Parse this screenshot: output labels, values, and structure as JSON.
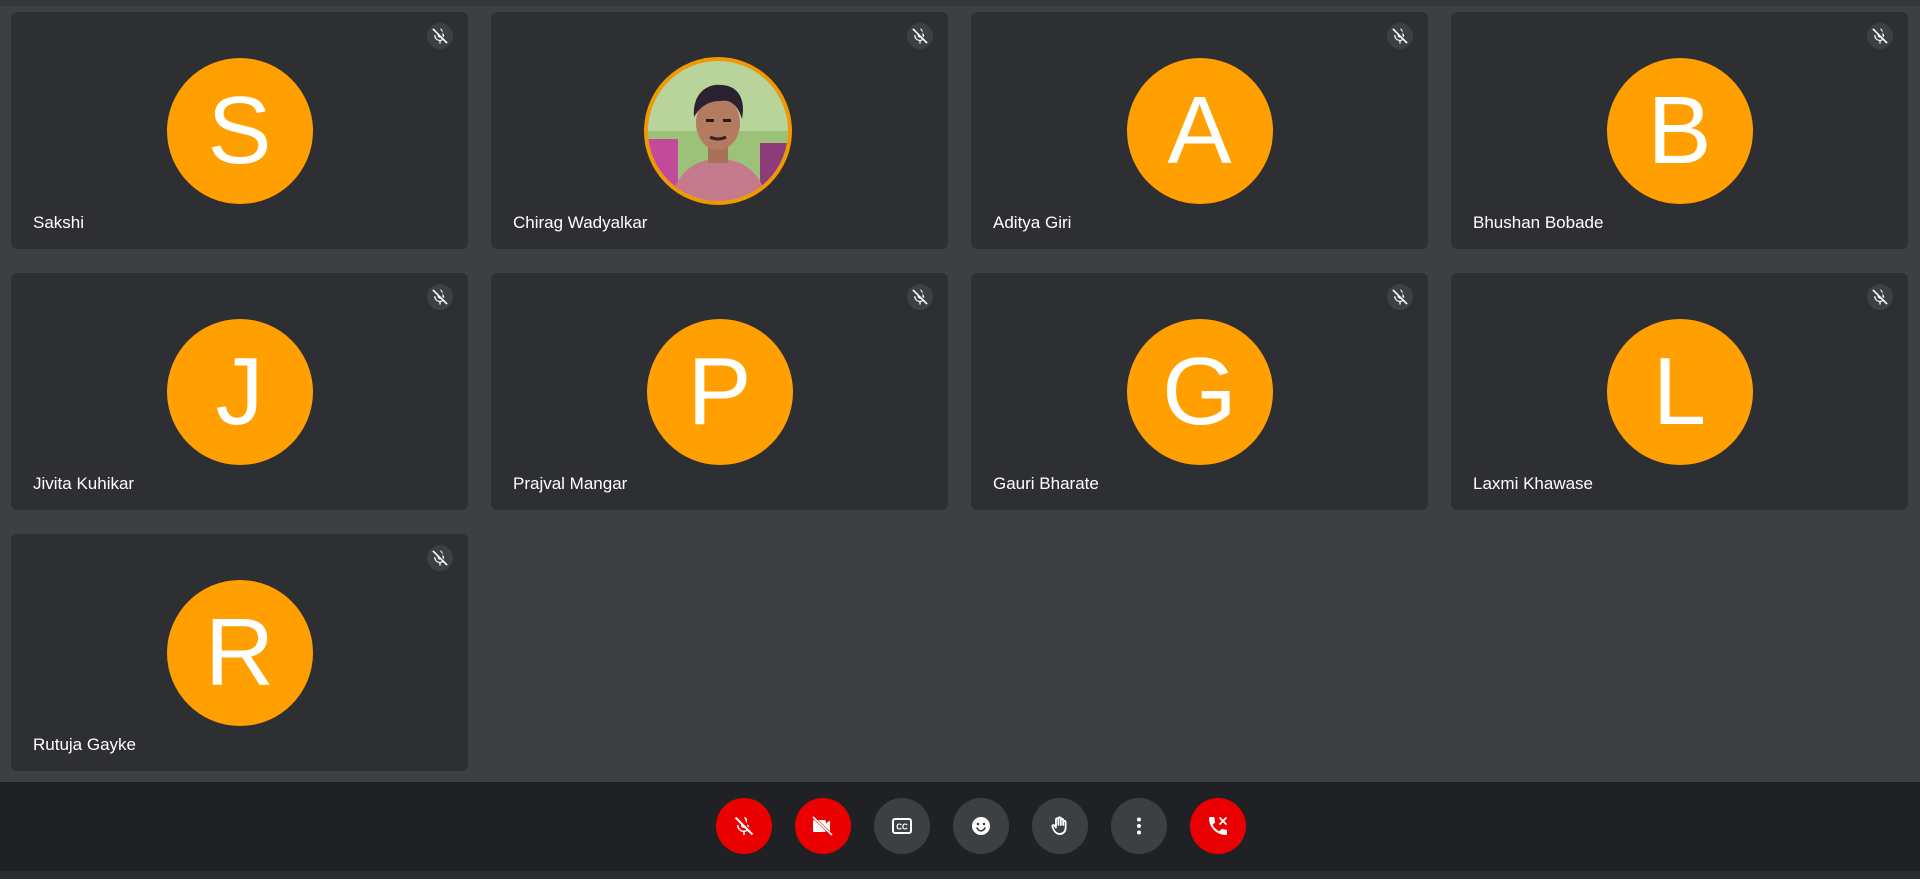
{
  "colors": {
    "avatar_bg": "#ffa000",
    "photo_ring": "#f29900",
    "danger": "#ea0000",
    "neutral_button": "#3c4043",
    "tile_bg": "#2e2f32",
    "stage_bg": "#3c4043",
    "toolbar_bg": "#202124"
  },
  "participants": [
    {
      "name": "Sakshi",
      "initial": "S",
      "muted": true,
      "mute_icon": "mic-off-icon",
      "avatar_type": "initial"
    },
    {
      "name": "Chirag Wadyalkar",
      "initial": "",
      "muted": true,
      "mute_icon": "mic-off-icon",
      "avatar_type": "photo"
    },
    {
      "name": "Aditya Giri",
      "initial": "A",
      "muted": true,
      "mute_icon": "mic-off-icon",
      "avatar_type": "initial"
    },
    {
      "name": "Bhushan Bobade",
      "initial": "B",
      "muted": true,
      "mute_icon": "mic-off-icon",
      "avatar_type": "initial"
    },
    {
      "name": "Jivita Kuhikar",
      "initial": "J",
      "muted": true,
      "mute_icon": "mic-off-icon",
      "avatar_type": "initial"
    },
    {
      "name": "Prajval Mangar",
      "initial": "P",
      "muted": true,
      "mute_icon": "mic-off-icon",
      "avatar_type": "initial"
    },
    {
      "name": "Gauri Bharate",
      "initial": "G",
      "muted": true,
      "mute_icon": "mic-off-icon",
      "avatar_type": "initial"
    },
    {
      "name": "Laxmi Khawase",
      "initial": "L",
      "muted": true,
      "mute_icon": "mic-off-icon",
      "avatar_type": "initial"
    },
    {
      "name": "Rutuja Gayke",
      "initial": "R",
      "muted": true,
      "mute_icon": "mic-off-icon",
      "avatar_type": "initial"
    }
  ],
  "toolbar": {
    "buttons": [
      {
        "name": "mic-toggle-button",
        "icon": "mic-off-icon",
        "style": "danger"
      },
      {
        "name": "camera-toggle-button",
        "icon": "videocam-off-icon",
        "style": "danger"
      },
      {
        "name": "captions-button",
        "icon": "closed-captions-icon",
        "style": "neutral"
      },
      {
        "name": "reactions-button",
        "icon": "emoji-icon",
        "style": "neutral"
      },
      {
        "name": "raise-hand-button",
        "icon": "hand-icon",
        "style": "neutral"
      },
      {
        "name": "more-options-button",
        "icon": "more-vert-icon",
        "style": "neutral"
      },
      {
        "name": "leave-call-button",
        "icon": "call-end-icon",
        "style": "danger"
      }
    ]
  }
}
